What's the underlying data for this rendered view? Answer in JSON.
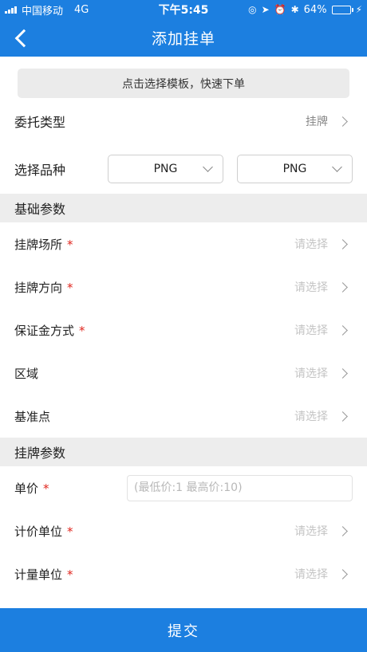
{
  "status_bar": {
    "carrier": "中国移动",
    "network": "4G",
    "time": "下午5:45",
    "battery": "64%",
    "battery_level": 0.64
  },
  "nav": {
    "title": "添加挂单"
  },
  "template_button": "点击选择模板，快速下单",
  "order_type": {
    "label": "委托类型",
    "value": "挂牌"
  },
  "variety": {
    "label": "选择品种",
    "select1": "PNG",
    "select2": "PNG"
  },
  "section_basic": "基础参数",
  "basic_fields": [
    {
      "label": "挂牌场所",
      "required": true,
      "value": "请选择"
    },
    {
      "label": "挂牌方向",
      "required": true,
      "value": "请选择"
    },
    {
      "label": "保证金方式",
      "required": true,
      "value": "请选择"
    },
    {
      "label": "区域",
      "required": false,
      "value": "请选择"
    },
    {
      "label": "基准点",
      "required": false,
      "value": "请选择"
    }
  ],
  "section_listing": "挂牌参数",
  "unit_price": {
    "label": "单价",
    "placeholder": "(最低价:1 最高价:10)"
  },
  "listing_fields": [
    {
      "label": "计价单位",
      "required": true,
      "value": "请选择"
    },
    {
      "label": "计量单位",
      "required": true,
      "value": "请选择"
    }
  ],
  "required_mark": "*",
  "submit": "提交",
  "colors": {
    "primary": "#1c7fe0",
    "required": "#e0261e",
    "section_bg": "#ededed"
  }
}
